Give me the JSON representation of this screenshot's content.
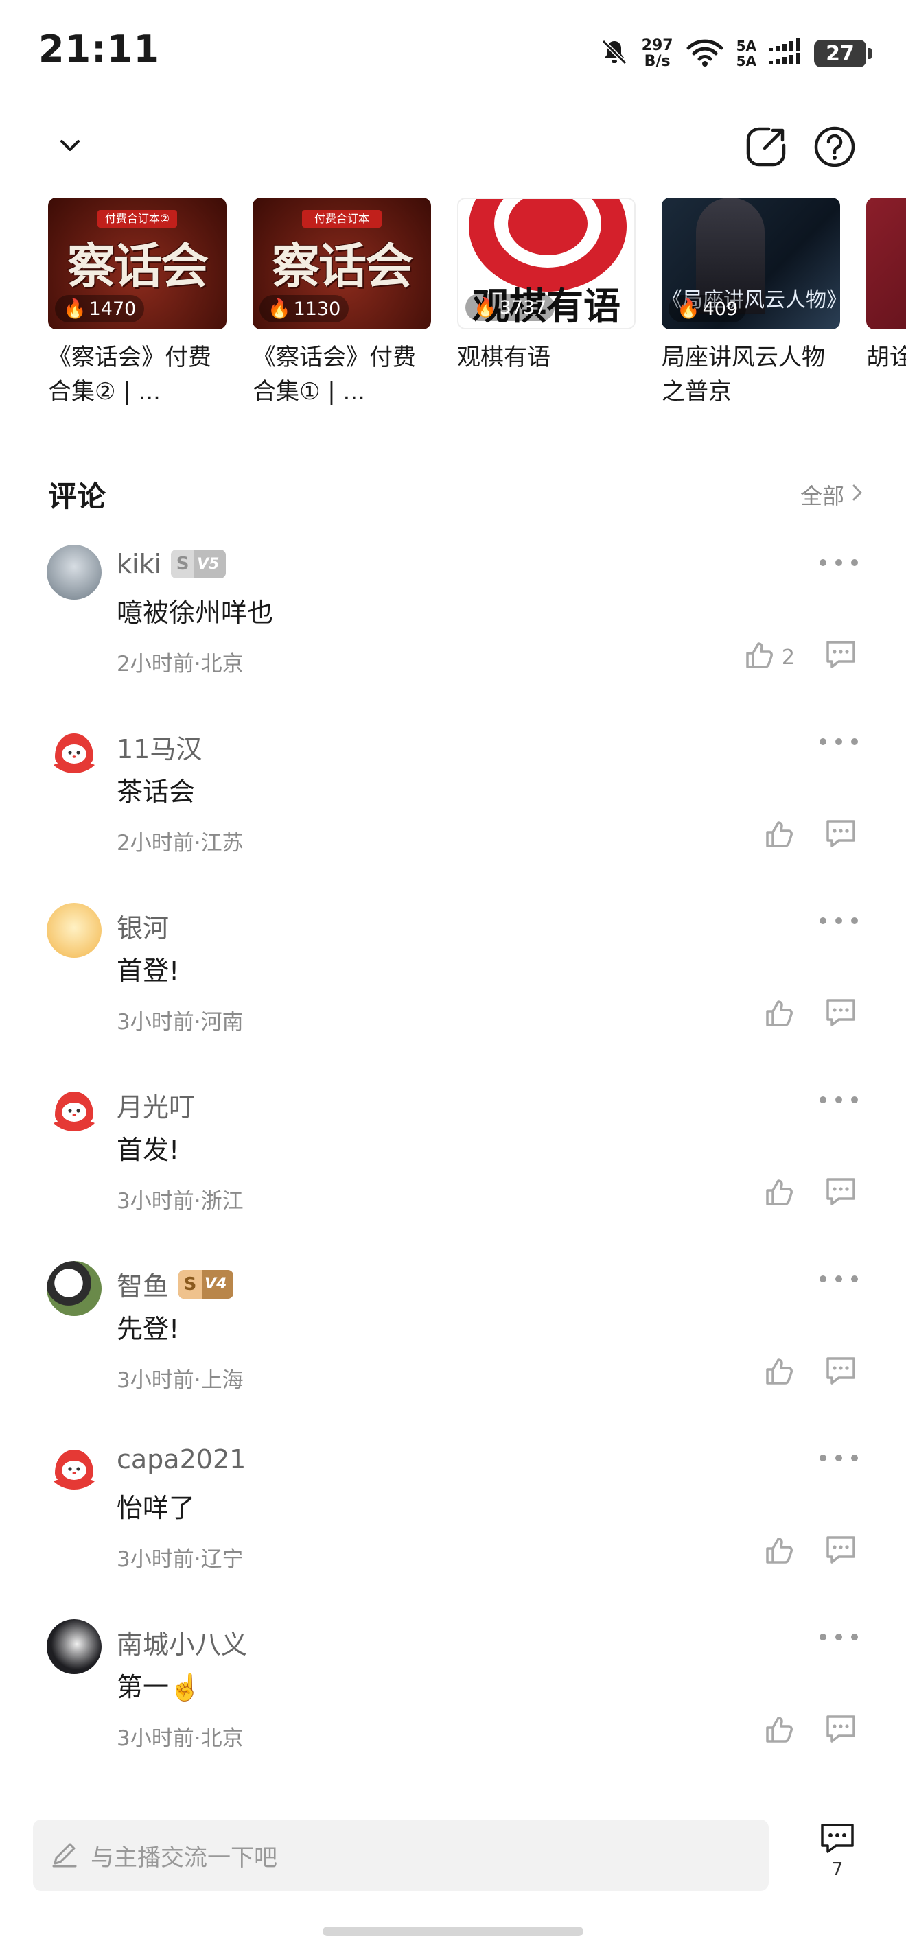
{
  "status_bar": {
    "time": "21:11",
    "net_speed_value": "297",
    "net_speed_unit": "B/s",
    "signal_label_1": "5A",
    "signal_label_2": "5A",
    "battery": "27"
  },
  "header": {
    "collapse_icon": "chevron-down-icon",
    "share_icon": "share-icon",
    "help_icon": "question-icon"
  },
  "recommendations": [
    {
      "badge": "付费合订本②",
      "thumb_text": "察话会",
      "play_count": "1470",
      "title": "《察话会》付费合集② | ..."
    },
    {
      "badge": "付费合订本",
      "thumb_text": "察话会",
      "play_count": "1130",
      "title": "《察话会》付费合集① | ..."
    },
    {
      "badge": "",
      "thumb_text": "观棋有语",
      "play_count": "3737",
      "title": "观棋有语"
    },
    {
      "badge": "",
      "thumb_text": "《局座讲风云人物》",
      "play_count": "409",
      "title": "局座讲风云人物之普京"
    },
    {
      "badge": "",
      "thumb_text": "",
      "play_count": "",
      "title": "胡诠"
    }
  ],
  "comments_section": {
    "title": "评论",
    "see_all": "全部"
  },
  "comments": [
    {
      "user": "kiki",
      "vip": "V5",
      "vip_s": "S",
      "text": "噫被徐州咩也",
      "meta": "2小时前·北京",
      "likes": "2"
    },
    {
      "user": "11马汉",
      "vip": "",
      "vip_s": "",
      "text": "茶话会",
      "meta": "2小时前·江苏",
      "likes": ""
    },
    {
      "user": "银河",
      "vip": "",
      "vip_s": "",
      "text": "首登!",
      "meta": "3小时前·河南",
      "likes": ""
    },
    {
      "user": "月光叮",
      "vip": "",
      "vip_s": "",
      "text": "首发!",
      "meta": "3小时前·浙江",
      "likes": ""
    },
    {
      "user": "智鱼",
      "vip": "V4",
      "vip_s": "S",
      "text": "先登!",
      "meta": "3小时前·上海",
      "likes": ""
    },
    {
      "user": "capa2021",
      "vip": "",
      "vip_s": "",
      "text": "怡咩了",
      "meta": "3小时前·辽宁",
      "likes": ""
    },
    {
      "user": "南城小八义",
      "vip": "",
      "vip_s": "",
      "text": "第一☝️",
      "meta": "3小时前·北京",
      "likes": ""
    }
  ],
  "bottom_bar": {
    "input_placeholder": "与主播交流一下吧",
    "comment_count": "7"
  },
  "colors": {
    "accent_red": "#e53935",
    "text_primary": "#1a1a1a",
    "text_secondary": "#8a8a8a"
  }
}
